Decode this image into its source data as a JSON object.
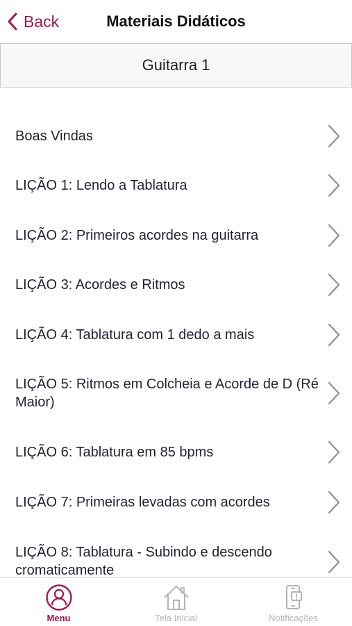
{
  "nav": {
    "back_label": "Back",
    "title": "Materiais Didáticos"
  },
  "course": {
    "title": "Guitarra 1"
  },
  "lessons": [
    {
      "label": "Boas Vindas"
    },
    {
      "label": "LIÇÃO 1: Lendo a Tablatura"
    },
    {
      "label": "LIÇÃO 2: Primeiros acordes na guitarra"
    },
    {
      "label": "LIÇÃO 3: Acordes e Ritmos"
    },
    {
      "label": "LIÇÃO 4: Tablatura com 1 dedo a mais"
    },
    {
      "label": "LIÇÃO 5: Ritmos em Colcheia e Acorde de D (Ré Maior)"
    },
    {
      "label": "LIÇÃO 6: Tablatura em 85 bpms"
    },
    {
      "label": "LIÇÃO 7: Primeiras levadas com acordes"
    },
    {
      "label": "LIÇÃO 8: Tablatura - Subindo e descendo cromaticamente"
    }
  ],
  "tabs": [
    {
      "label": "Menu",
      "icon": "profile-icon",
      "active": true
    },
    {
      "label": "Tela Inicial",
      "icon": "home-icon",
      "active": false
    },
    {
      "label": "Notificações",
      "icon": "notification-phone-icon",
      "active": false
    }
  ],
  "colors": {
    "accent": "#a3174f",
    "text": "#1f2233",
    "inactive_tab": "#b4b4b4",
    "chevron": "#8e8e93"
  }
}
